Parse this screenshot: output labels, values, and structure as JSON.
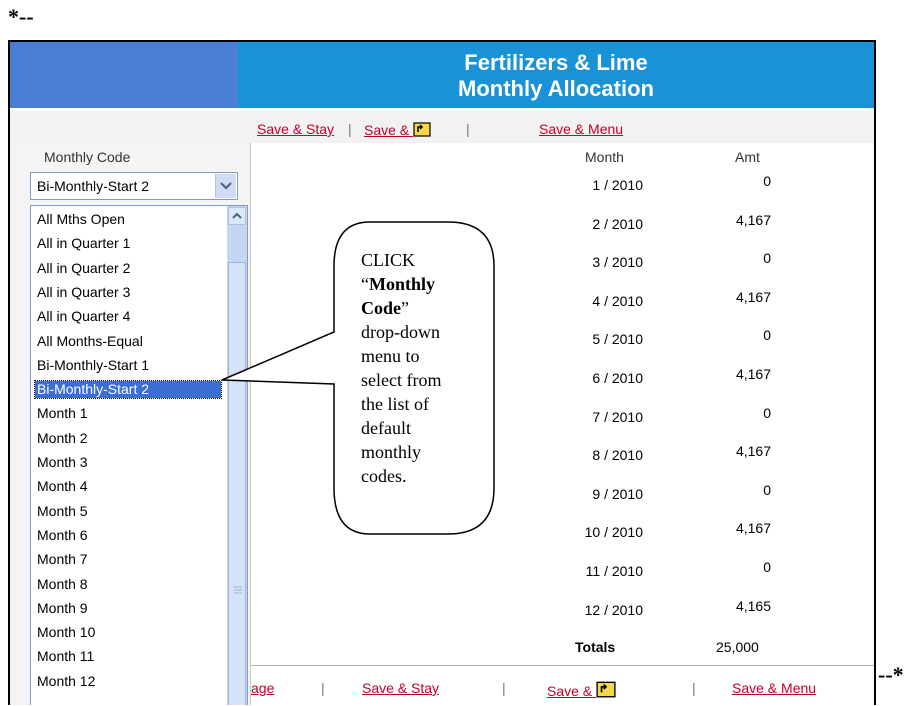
{
  "markers": {
    "start": "*--",
    "end": "--*"
  },
  "header": {
    "title_line1": "Fertilizers & Lime",
    "title_line2": "Monthly Allocation"
  },
  "toolbar": {
    "save_stay": "Save & Stay",
    "save_up": "Save &",
    "save_menu": "Save & Menu",
    "separator": "|",
    "up_icon": "folder-up-icon"
  },
  "left": {
    "column_header": "Monthly Code",
    "selected_value": "Bi-Monthly-Start 2",
    "options": [
      "All Mths Open",
      "All in Quarter 1",
      "All in Quarter 2",
      "All in Quarter 3",
      "All in Quarter 4",
      "All Months-Equal",
      "Bi-Monthly-Start 1",
      "Bi-Monthly-Start 2",
      "Month 1",
      "Month 2",
      "Month 3",
      "Month 4",
      "Month 5",
      "Month 6",
      "Month 7",
      "Month 8",
      "Month 9",
      "Month 10",
      "Month 11",
      "Month 12"
    ],
    "highlighted_index": 7
  },
  "table": {
    "month_header": "Month",
    "amt_header": "Amt",
    "rows": [
      {
        "month": "1 / 2010",
        "amt": "0"
      },
      {
        "month": "2 / 2010",
        "amt": "4,167"
      },
      {
        "month": "3 / 2010",
        "amt": "0"
      },
      {
        "month": "4 / 2010",
        "amt": "4,167"
      },
      {
        "month": "5 / 2010",
        "amt": "0"
      },
      {
        "month": "6 / 2010",
        "amt": "4,167"
      },
      {
        "month": "7 / 2010",
        "amt": "0"
      },
      {
        "month": "8 / 2010",
        "amt": "4,167"
      },
      {
        "month": "9 / 2010",
        "amt": "0"
      },
      {
        "month": "10 / 2010",
        "amt": "4,167"
      },
      {
        "month": "11 / 2010",
        "amt": "0"
      },
      {
        "month": "12 / 2010",
        "amt": "4,165"
      }
    ],
    "totals_label": "Totals",
    "totals_value": "25,000"
  },
  "bottom": {
    "page_fragment": "age",
    "save_stay": "Save & Stay",
    "save_up": "Save &",
    "save_menu": "Save & Menu",
    "separator": "|"
  },
  "callout": {
    "line1": "CLICK",
    "quote_open": "“",
    "bold": "Monthly Code",
    "quote_close": "”",
    "lines": [
      "drop-down",
      "menu to",
      "select from",
      "the list of",
      "default",
      "monthly",
      "codes."
    ]
  }
}
